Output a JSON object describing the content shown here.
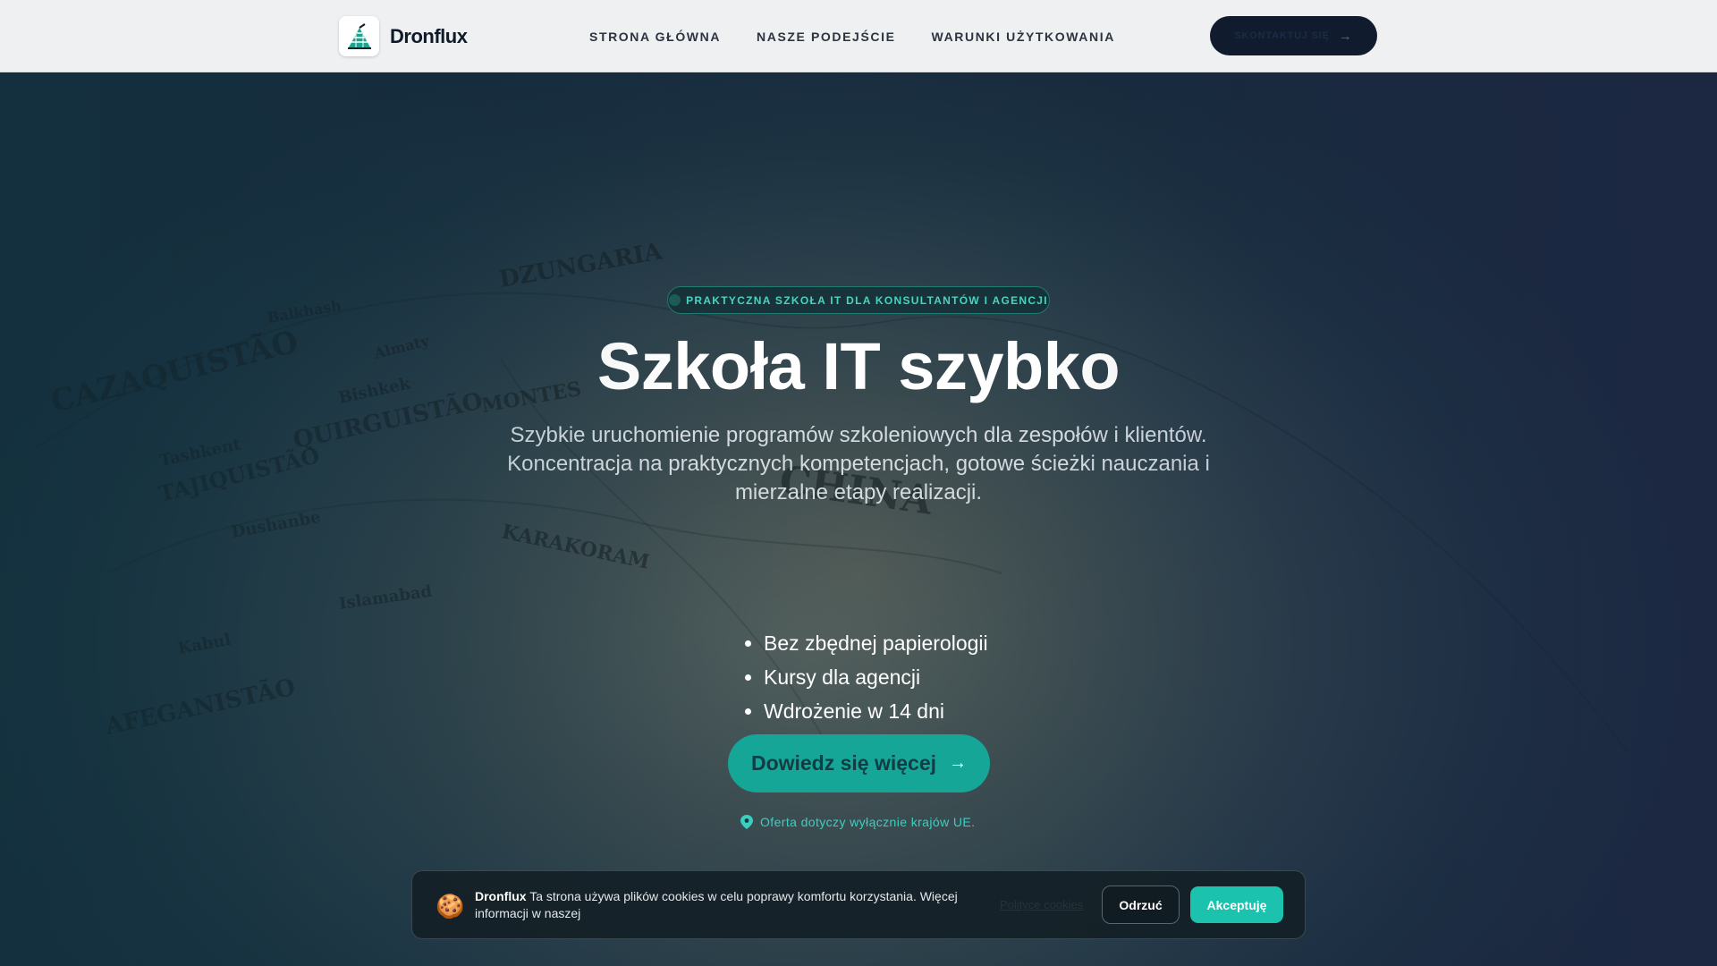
{
  "header": {
    "brand": "Dronflux",
    "nav": [
      {
        "label": "STRONA GŁÓWNA"
      },
      {
        "label": "NASZE PODEJŚCIE"
      },
      {
        "label": "WARUNKI UŻYTKOWANIA"
      }
    ],
    "contact_label": "SKONTAKTUJ SIĘ",
    "contact_icon": "arrow-right-icon"
  },
  "hero": {
    "badge": "PRAKTYCZNA SZKOŁA IT DLA KONSULTANTÓW I AGENCJI",
    "title": "Szkoła IT szybko",
    "subtitle": "Szybkie uruchomienie programów szkoleniowych dla zespołów i klientów. Koncentracja na praktycznych kompetencjach, gotowe ścieżki nauczania i mierzalne etapy realizacji.",
    "features": [
      "Bez zbędnej papierologii",
      "Kursy dla agencji",
      "Wdrożenie w 14 dni"
    ],
    "cta_label": "Dowiedz się więcej",
    "cta_icon": "arrow-right-icon",
    "offer_note": "Oferta dotyczy wyłącznie krajów UE.",
    "offer_icon": "map-pin-icon",
    "map_labels": [
      "CAZAQUISTÃO",
      "QUIRGUISTÃO",
      "Bishkek",
      "Almaty",
      "DZUNGARIA",
      "MONTES",
      "TAJIQUISTÃO",
      "KARAKORAM",
      "Balkhash",
      "Tashkent",
      "Dushanbe",
      "Islamabad",
      "Kabul",
      "AFEGANISTÃO",
      "CHINA"
    ]
  },
  "cookie": {
    "icon": "cookie-icon",
    "brand": "Dronflux",
    "text": "Ta strona używa plików cookies w celu poprawy komfortu korzystania. Więcej informacji w naszej",
    "policy_link": "Polityce cookies",
    "reject_label": "Odrzuć",
    "accept_label": "Akceptuję"
  },
  "colors": {
    "accent": "#16a697",
    "accent_text": "#48d4bf",
    "header_bg": "#eef0f2",
    "dark_button": "#111b2e"
  }
}
